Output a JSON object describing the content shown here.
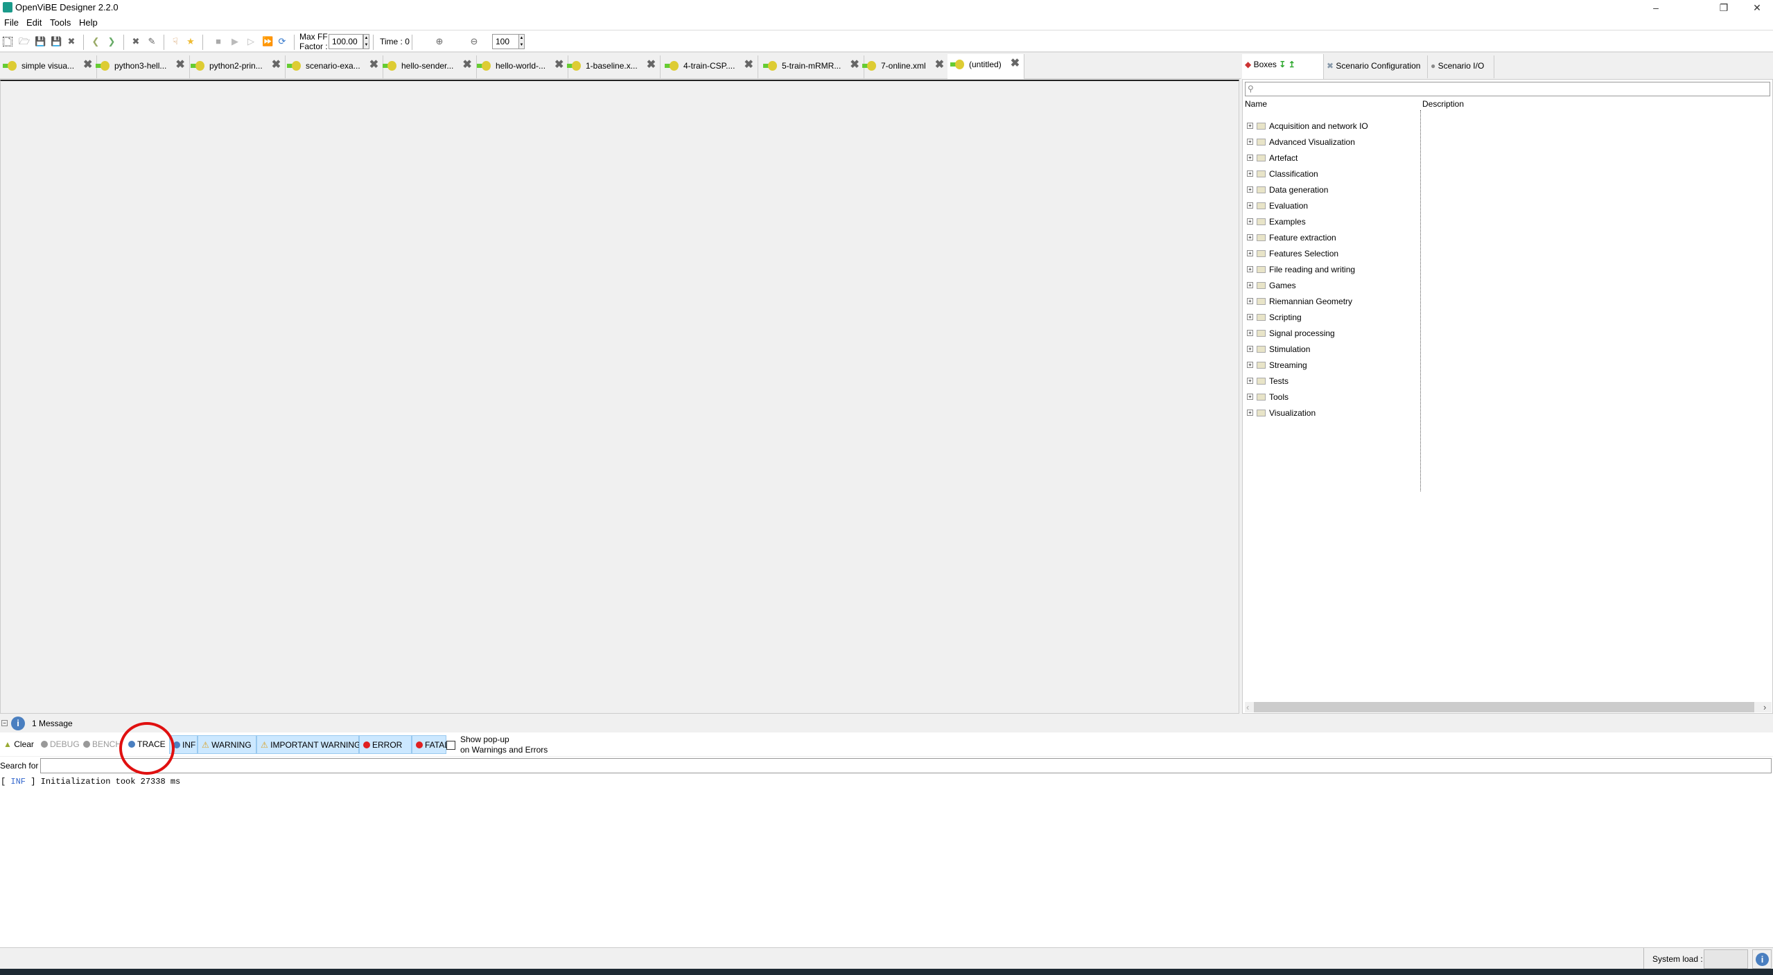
{
  "window": {
    "title": "OpenViBE Designer 2.2.0"
  },
  "menu": [
    "File",
    "Edit",
    "Tools",
    "Help"
  ],
  "toolbar": {
    "max_ff_label_1": "Max FF",
    "max_ff_label_2": "Factor :",
    "max_ff_value": "100.00",
    "time_label": "Time : 0",
    "zoom_value": "100"
  },
  "tabs": [
    {
      "label": "simple visua..."
    },
    {
      "label": "python3-hell..."
    },
    {
      "label": "python2-prin..."
    },
    {
      "label": "scenario-exa..."
    },
    {
      "label": "hello-sender..."
    },
    {
      "label": "hello-world-..."
    },
    {
      "label": "1-baseline.x..."
    },
    {
      "label": "4-train-CSP...."
    },
    {
      "label": "5-train-mRMR..."
    },
    {
      "label": "7-online.xml"
    },
    {
      "label": "(untitled)",
      "active": true
    }
  ],
  "right_panel": {
    "tabs": [
      "Boxes",
      "Scenario Configuration",
      "Scenario I/O"
    ],
    "columns": [
      "Name",
      "Description"
    ],
    "items": [
      "Acquisition and network IO",
      "Advanced Visualization",
      "Artefact",
      "Classification",
      "Data generation",
      "Evaluation",
      "Examples",
      "Feature extraction",
      "Features Selection",
      "File reading and writing",
      "Games",
      "Riemannian Geometry",
      "Scripting",
      "Signal processing",
      "Stimulation",
      "Streaming",
      "Tests",
      "Tools",
      "Visualization"
    ]
  },
  "messages": {
    "count_label": "1 Message",
    "clear": "Clear",
    "filters": [
      {
        "label": "DEBUG",
        "on": false,
        "color": "#999999"
      },
      {
        "label": "BENCH",
        "on": false,
        "color": "#999999"
      },
      {
        "label": "TRACE",
        "on": false,
        "color": "#4a7fc0"
      },
      {
        "label": "INF",
        "on": true,
        "color": "#4a7fc0"
      },
      {
        "label": "WARNING",
        "on": true,
        "color": "#d9a020"
      },
      {
        "label": "IMPORTANT WARNING",
        "on": true,
        "color": "#d9a020"
      },
      {
        "label": "ERROR",
        "on": true,
        "color": "#e02020"
      },
      {
        "label": "FATAL",
        "on": true,
        "color": "#e02020"
      }
    ],
    "popup_1": "Show pop-up",
    "popup_2": "on Warnings and Errors",
    "search_label": "Search for :",
    "search_value": "",
    "log": [
      {
        "open": "[ ",
        "level": "INF",
        "close": " ] ",
        "text": "Initialization took 27338 ms"
      }
    ]
  },
  "status": {
    "system_load_label": "System load :"
  },
  "annotation": {
    "highlight": "TRACE",
    "color": "#e01010"
  }
}
